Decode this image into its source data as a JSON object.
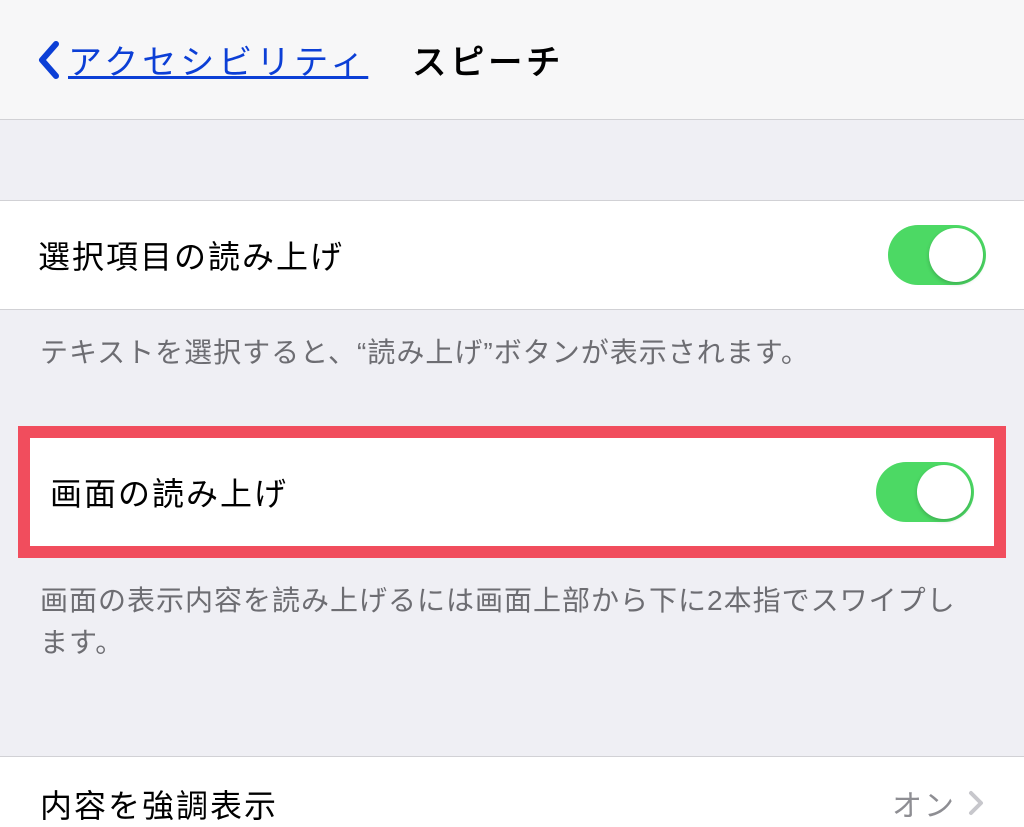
{
  "nav": {
    "back_label": "アクセシビリティ",
    "title": "スピーチ"
  },
  "section1": {
    "row_label": "選択項目の読み上げ",
    "description": "テキストを選択すると、“読み上げ”ボタンが表示されます。"
  },
  "section2": {
    "row_label": "画面の読み上げ",
    "description": "画面の表示内容を読み上げるには画面上部から下に2本指でスワイプします。"
  },
  "section3": {
    "row_label": "内容を強調表示",
    "value": "オン"
  }
}
